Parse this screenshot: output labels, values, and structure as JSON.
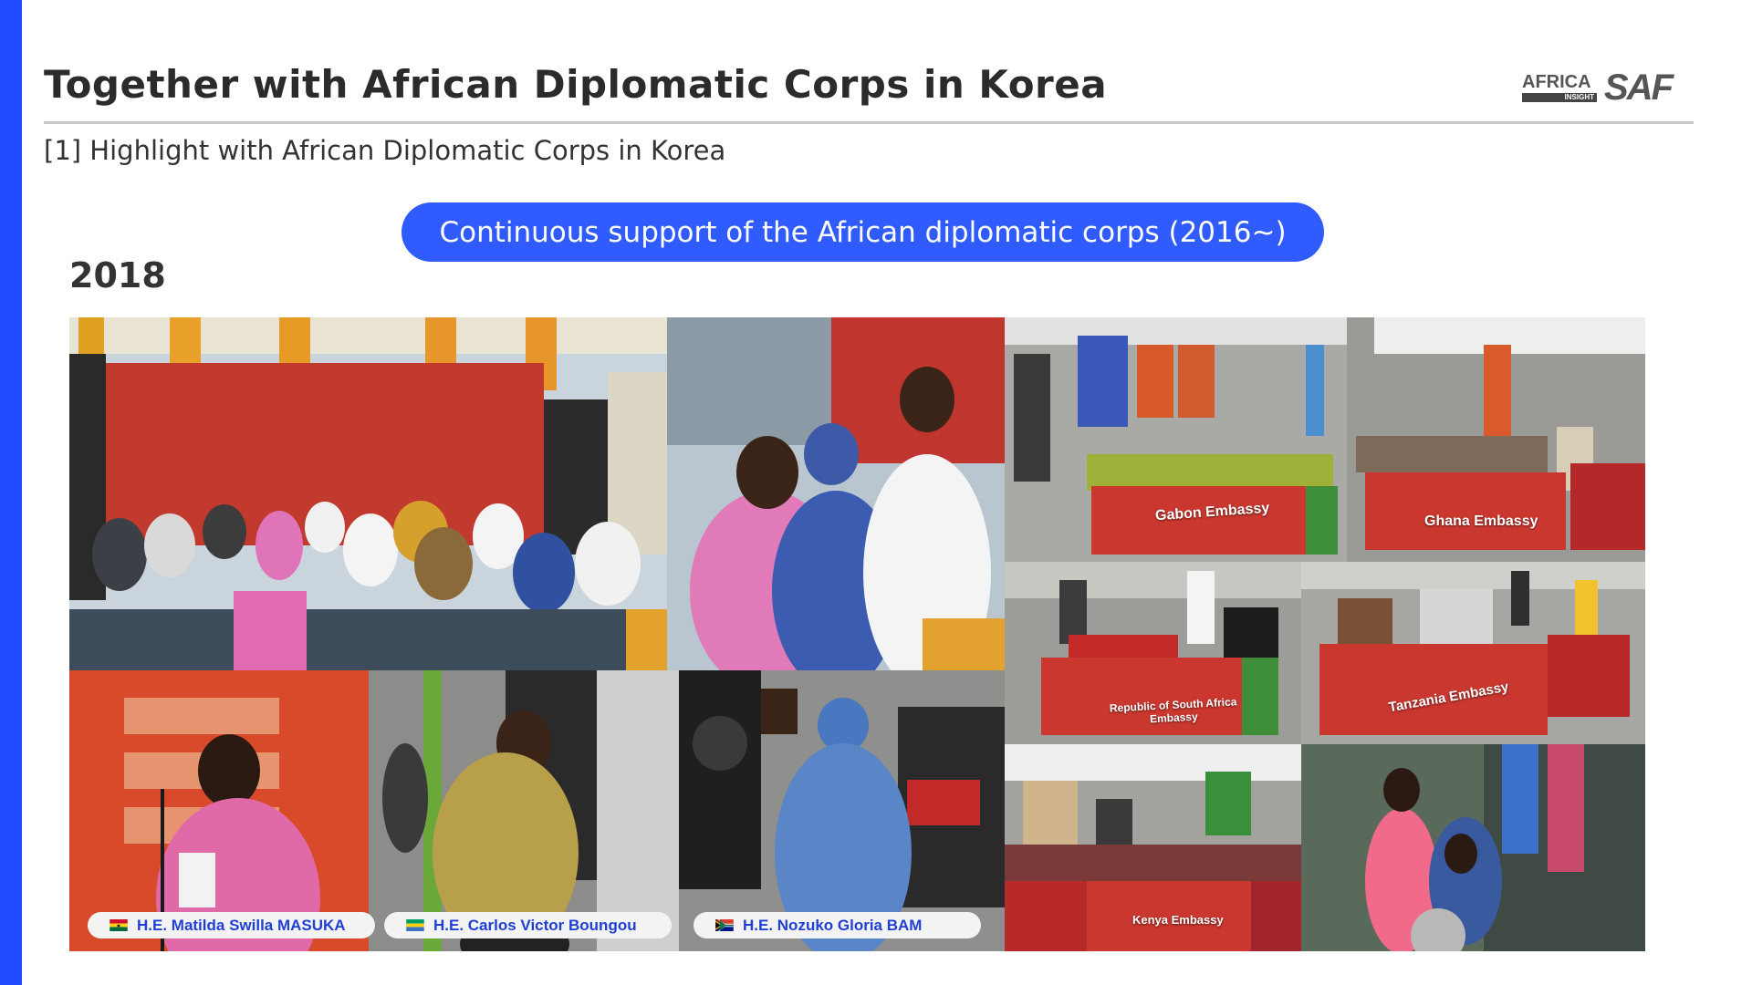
{
  "header": {
    "title": "Together with African Diplomatic Corps in Korea",
    "subtitle": "[1] Highlight with African Diplomatic Corps in Korea"
  },
  "logos": {
    "africa_insight": {
      "word": "AFRICA",
      "tag": "INSIGHT"
    },
    "saf": "SAF"
  },
  "banner": {
    "text": "Continuous support of the African diplomatic corps (2016~)"
  },
  "section": {
    "year": "2018"
  },
  "embassy_tables": [
    {
      "label": "Gabon Embassy"
    },
    {
      "label": "Ghana Embassy"
    },
    {
      "label": "Republic of South Africa Embassy"
    },
    {
      "label": "Tanzania Embassy"
    },
    {
      "label": "Kenya Embassy"
    }
  ],
  "captions": [
    {
      "name": "H.E. Matilda Swilla MASUKA",
      "flag_icon": "ghana-flag-icon"
    },
    {
      "name": "H.E. Carlos Victor Boungou",
      "flag_icon": "gabon-flag-icon"
    },
    {
      "name": "H.E. Nozuko Gloria BAM",
      "flag_icon": "south-africa-flag-icon"
    }
  ],
  "colors": {
    "accent": "#1f4dff",
    "pill": "#2f5bff",
    "caption_text": "#1f3fd6",
    "title_text": "#2b2b2b"
  }
}
